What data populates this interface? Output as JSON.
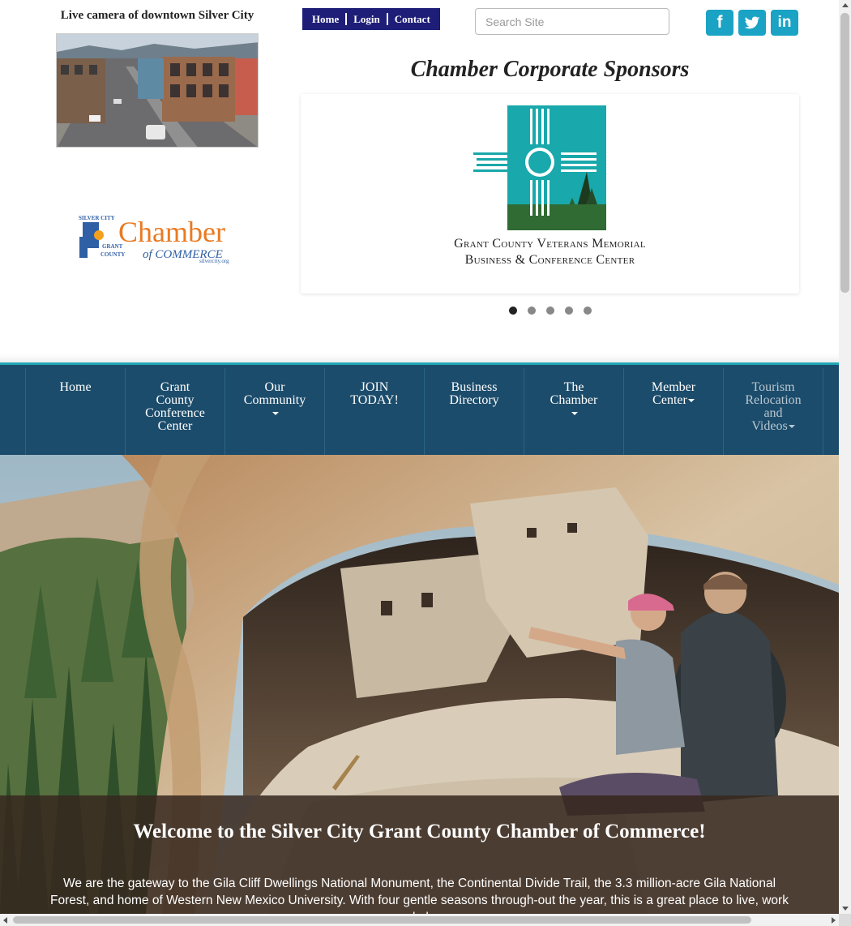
{
  "header": {
    "camera_title": "Live camera of downtown Silver City",
    "logo": {
      "top_text": "SILVER CITY",
      "grant": "GRANT",
      "county": "COUNTY",
      "chamber": "Chamber",
      "of_commerce": "of COMMERCE",
      "site": "silvercity.org"
    }
  },
  "topnav": {
    "items": [
      {
        "label": "Home"
      },
      {
        "label": "Login"
      },
      {
        "label": "Contact"
      }
    ]
  },
  "search": {
    "placeholder": "Search Site"
  },
  "social": {
    "facebook_label": "f",
    "twitter_icon": "twitter-icon",
    "linkedin_label": "in",
    "color": "#1aa3c4"
  },
  "sponsors": {
    "title": "Chamber Corporate Sponsors",
    "current_name_line1": "Grant County Veterans Memorial",
    "current_name_line2": "Business & Conference Center",
    "slide_count": 5,
    "active_slide": 1,
    "dots": [
      "1",
      "2",
      "3",
      "4",
      "5"
    ]
  },
  "mainnav": {
    "bg_color": "#1c4c6b",
    "accent_color": "#22a7b7",
    "items": [
      {
        "lines": [
          "Home"
        ],
        "dropdown": false
      },
      {
        "lines": [
          "Grant",
          "County",
          "Conference",
          "Center"
        ],
        "dropdown": false
      },
      {
        "lines": [
          "Our",
          "Community"
        ],
        "dropdown": true
      },
      {
        "lines": [
          "JOIN",
          "TODAY!"
        ],
        "dropdown": false
      },
      {
        "lines": [
          "Business",
          "Directory"
        ],
        "dropdown": false
      },
      {
        "lines": [
          "The",
          "Chamber"
        ],
        "dropdown": true
      },
      {
        "lines": [
          "Member",
          "Center"
        ],
        "dropdown": true
      },
      {
        "lines": [
          "Tourism",
          "Relocation",
          "and",
          "Videos"
        ],
        "dropdown": true
      }
    ]
  },
  "hero": {
    "welcome_title": "Welcome to the Silver City Grant County Chamber of Commerce!",
    "welcome_text": "We are the gateway to the Gila Cliff Dwellings National Monument, the Continental Divide Trail, the 3.3 million-acre Gila National Forest, and home of Western New Mexico University. With four gentle seasons through-out the year, this is a great place to live, work and play."
  }
}
